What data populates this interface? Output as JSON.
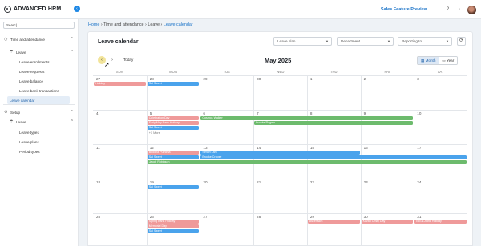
{
  "app": {
    "name": "ADVANCED HRM",
    "preview_link": "Sales Feature Preview"
  },
  "topbar_icons": [
    "help-icon",
    "bell-icon"
  ],
  "sidebar": {
    "search_value": "Searc|",
    "items": [
      {
        "label": "Time and attendance",
        "icon": "clock-icon",
        "level": 0,
        "chevron": "^"
      },
      {
        "label": "Leave",
        "icon": "beach-icon",
        "level": 1,
        "chevron": "^"
      },
      {
        "label": "Leave enrollments",
        "level": 2
      },
      {
        "label": "Leave requests",
        "level": 2
      },
      {
        "label": "Leave balance",
        "level": 2
      },
      {
        "label": "Leave bank transactions",
        "level": 2
      },
      {
        "label": "Leave calendar",
        "level": 2,
        "active": true
      },
      {
        "label": "Setup",
        "icon": "gear-icon",
        "level": 0,
        "chevron": "^"
      },
      {
        "label": "Leave",
        "icon": "beach-icon",
        "level": 1,
        "chevron": "^"
      },
      {
        "label": "Leave types",
        "level": 2
      },
      {
        "label": "Leave plans",
        "level": 2
      },
      {
        "label": "Period types",
        "level": 2
      }
    ]
  },
  "breadcrumb": {
    "home": "Home",
    "sep": "›",
    "items": [
      "Time and attendance",
      "Leave"
    ],
    "current": "Leave calendar"
  },
  "panel": {
    "title": "Leave calendar",
    "filters": [
      {
        "placeholder": "Leave plan"
      },
      {
        "placeholder": "Department"
      },
      {
        "placeholder": "Reporting to"
      }
    ]
  },
  "calendar": {
    "prev": "‹",
    "next": "›",
    "today_label": "Today",
    "month_title": "May 2025",
    "views": [
      {
        "label": "Month",
        "selected": true
      },
      {
        "label": "Year",
        "selected": false
      }
    ],
    "days_of_week": [
      "SUN",
      "MON",
      "TUE",
      "WED",
      "THU",
      "FRI",
      "SAT"
    ],
    "weeks": [
      {
        "dates": [
          "27",
          "28",
          "29",
          "30",
          "1",
          "2",
          "3"
        ],
        "events": [
          {
            "label": "Holiday",
            "start": 0,
            "span": 1,
            "color": "pink",
            "lane": 0
          },
          {
            "label": "Sal Sweet",
            "start": 1,
            "span": 1,
            "color": "blue",
            "lane": 0
          }
        ]
      },
      {
        "dates": [
          "4",
          "5",
          "6",
          "7",
          "8",
          "9",
          "10"
        ],
        "events": [
          {
            "label": "Celebration Day",
            "start": 1,
            "span": 1,
            "color": "pink",
            "lane": 0
          },
          {
            "label": "Cosmos Walker",
            "start": 2,
            "span": 4,
            "color": "green",
            "lane": 0
          },
          {
            "label": "Early May Bank Holiday",
            "start": 1,
            "span": 1,
            "color": "pink",
            "lane": 1
          },
          {
            "label": "Brooke Rogers",
            "start": 3,
            "span": 3,
            "color": "green",
            "lane": 1
          },
          {
            "label": "Sal Sweet",
            "start": 1,
            "span": 1,
            "color": "blue",
            "lane": 2
          }
        ],
        "more": {
          "label": "+1 More",
          "day": 1
        }
      },
      {
        "dates": [
          "11",
          "12",
          "13",
          "14",
          "15",
          "16",
          "17"
        ],
        "events": [
          {
            "label": "Buddha Purnima",
            "start": 1,
            "span": 1,
            "color": "pink",
            "lane": 0
          },
          {
            "label": "Simon Lam",
            "start": 2,
            "span": 3,
            "color": "blue",
            "lane": 0
          },
          {
            "label": "Sal Sweet",
            "start": 1,
            "span": 1,
            "color": "blue",
            "lane": 1
          },
          {
            "label": "Brooke Croose",
            "start": 2,
            "span": 5,
            "color": "blue",
            "lane": 1
          },
          {
            "label": "Jacob Robinson",
            "start": 1,
            "span": 6,
            "color": "green",
            "lane": 2
          }
        ]
      },
      {
        "dates": [
          "18",
          "19",
          "20",
          "21",
          "22",
          "23",
          "24"
        ],
        "events": [
          {
            "label": "Sal Sweet",
            "start": 1,
            "span": 1,
            "color": "blue",
            "lane": 0
          }
        ]
      },
      {
        "dates": [
          "25",
          "26",
          "27",
          "28",
          "29",
          "30",
          "31"
        ],
        "events": [
          {
            "label": "Spring Bank Holiday",
            "start": 1,
            "span": 1,
            "color": "pink",
            "lane": 0
          },
          {
            "label": "Memorial Day",
            "start": 1,
            "span": 1,
            "color": "pink",
            "lane": 1
          },
          {
            "label": "Sal Sweet",
            "start": 1,
            "span": 1,
            "color": "blue",
            "lane": 2
          },
          {
            "label": "Ascension",
            "start": 4,
            "span": 1,
            "color": "pink",
            "lane": 0
          },
          {
            "label": "Kazan Cristy Day",
            "start": 5,
            "span": 1,
            "color": "pink",
            "lane": 0
          },
          {
            "label": "Eid al-Adha Holiday",
            "start": 6,
            "span": 1,
            "color": "pink",
            "lane": 0
          }
        ]
      }
    ]
  },
  "colors": {
    "accent": "#1a73c8",
    "event_blue": "#4aa3ec",
    "event_pink": "#ef9a9a",
    "event_green": "#6dbb6d"
  }
}
